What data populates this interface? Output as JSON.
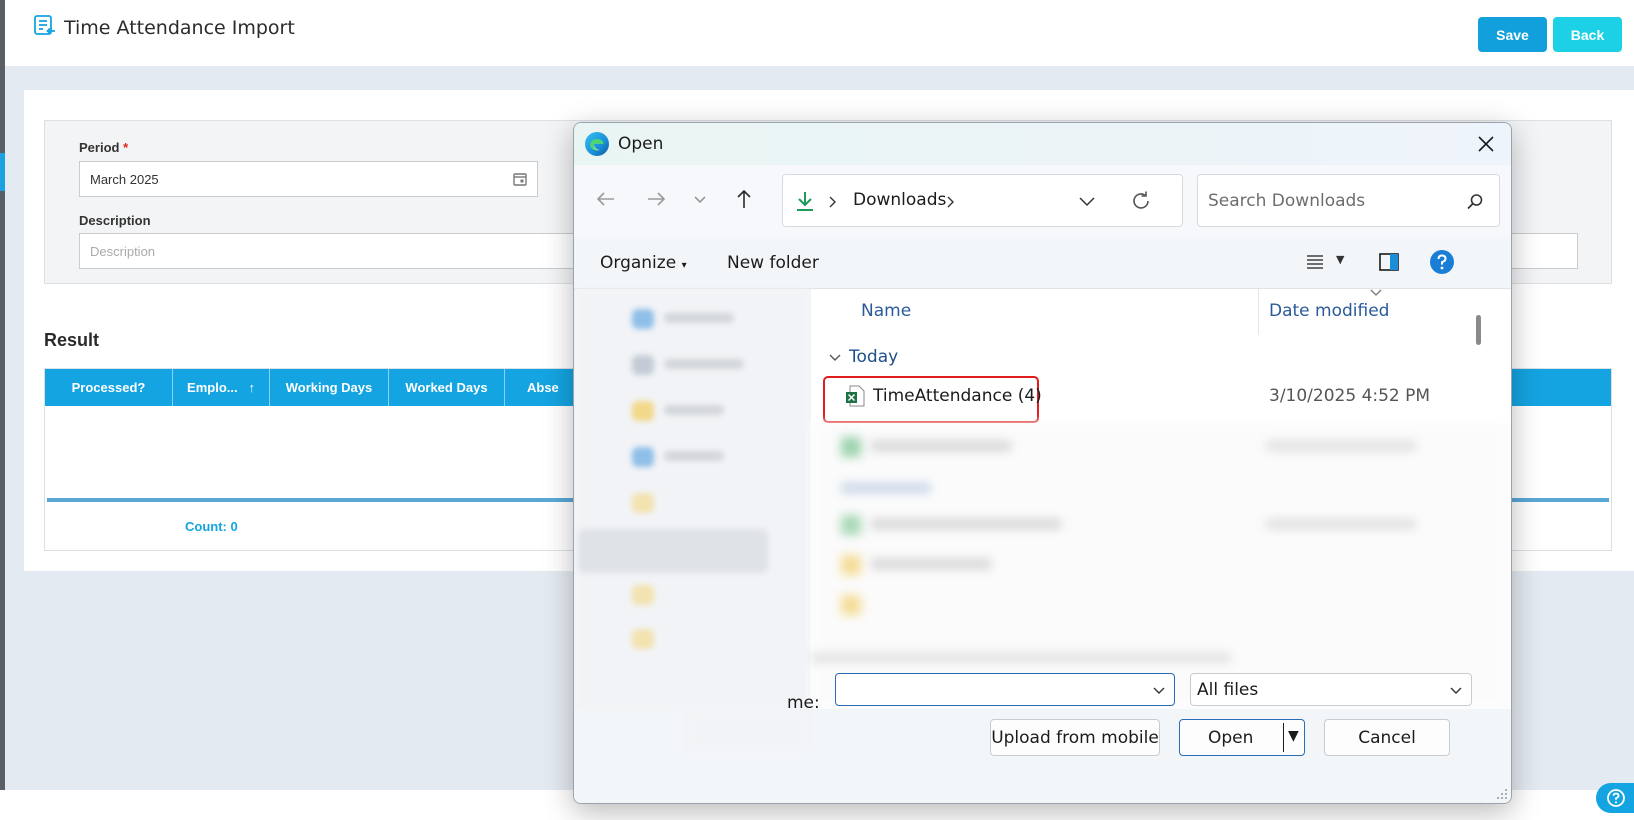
{
  "header": {
    "title": "Time Attendance Import",
    "save_label": "Save",
    "back_label": "Back"
  },
  "form": {
    "period_label": "Period",
    "period_required_mark": "*",
    "period_value": "March 2025",
    "description_label": "Description",
    "description_placeholder": "Description"
  },
  "result": {
    "title": "Result",
    "columns": [
      "Processed?",
      "Emplo...",
      "Working Days",
      "Worked Days",
      "Abse"
    ],
    "sort_indicator": "↑",
    "count_label": "Count: 0"
  },
  "dialog": {
    "title": "Open",
    "location": "Downloads",
    "search_placeholder": "Search Downloads",
    "organize_label": "Organize",
    "new_folder_label": "New folder",
    "columns": {
      "name": "Name",
      "date_modified": "Date modified"
    },
    "group": "Today",
    "files": [
      {
        "name": "TimeAttendance (4)",
        "date": "3/10/2025 4:52 PM",
        "type": "excel"
      }
    ],
    "file_name_label": "me:",
    "file_name_value": "",
    "file_type": "All files",
    "upload_mobile_label": "Upload from mobile",
    "open_label": "Open",
    "cancel_label": "Cancel"
  },
  "colors": {
    "primary": "#12a0dc",
    "back": "#1cd1e6",
    "grid_header": "#14a4e1",
    "highlight": "#e11d1d"
  }
}
